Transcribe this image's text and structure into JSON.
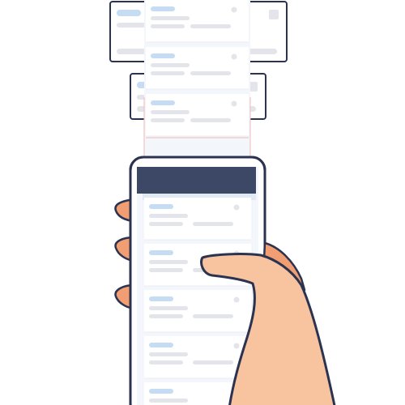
{
  "scene": {
    "illustration": "hand-holding-phone-scrolling-list",
    "colors": {
      "background": "#ffffff",
      "outline": "#2b3350",
      "phone_header": "#3d4866",
      "phone_body": "#ffffff",
      "screen_bg": "#f3f7fb",
      "card_bg": "#ffffff",
      "skin": "#f8c39f",
      "skin_shadow": "#f09e72",
      "title_pill": "#c5dcf2",
      "text_pill": "#e4e5ea",
      "dot": "#e4e5ea",
      "accent_line": "#f2b9b9"
    }
  },
  "phone": {
    "list_items": [
      {
        "kind": "card"
      },
      {
        "kind": "card"
      },
      {
        "kind": "card"
      },
      {
        "kind": "card"
      },
      {
        "kind": "card"
      }
    ]
  },
  "scroll_stream": {
    "items": [
      {
        "kind": "card"
      },
      {
        "kind": "card"
      },
      {
        "kind": "card"
      }
    ]
  },
  "floating_cards": [
    {
      "kind": "wide-card"
    },
    {
      "kind": "wide-card"
    }
  ]
}
